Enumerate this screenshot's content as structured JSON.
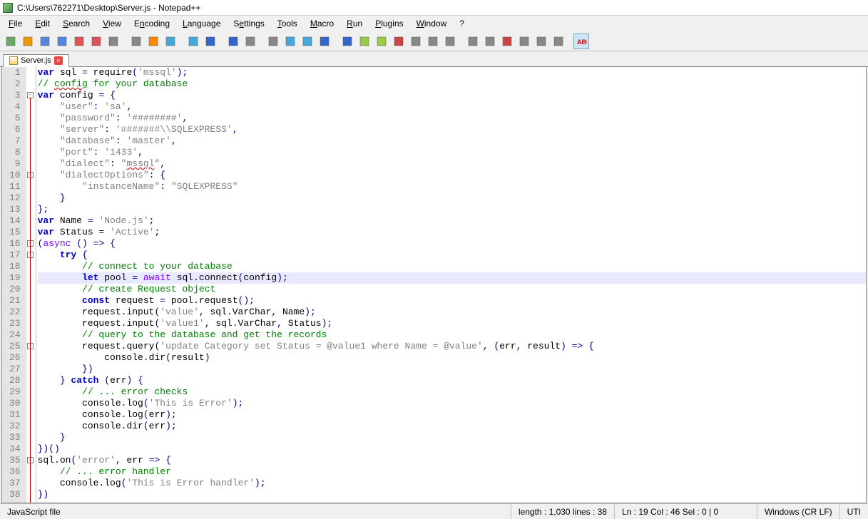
{
  "window": {
    "title": "C:\\Users\\762271\\Desktop\\Server.js - Notepad++"
  },
  "menu": [
    "File",
    "Edit",
    "Search",
    "View",
    "Encoding",
    "Language",
    "Settings",
    "Tools",
    "Macro",
    "Run",
    "Plugins",
    "Window",
    "?"
  ],
  "menu_underline_idx": [
    0,
    0,
    0,
    0,
    1,
    0,
    1,
    0,
    0,
    0,
    0,
    0,
    0
  ],
  "toolbar_icons": [
    "new-icon",
    "open-icon",
    "save-icon",
    "save-all-icon",
    "close-icon",
    "close-all-icon",
    "print-icon",
    "",
    "cut-icon",
    "copy-icon",
    "paste-icon",
    "",
    "undo-icon",
    "redo-icon",
    "",
    "find-icon",
    "replace-icon",
    "",
    "zoom-in-icon",
    "zoom-out-icon",
    "sync-v-icon",
    "sync-h-icon",
    "",
    "wrap-icon",
    "all-chars-icon",
    "indent-icon",
    "lang-icon",
    "doc-map-icon",
    "func-list-icon",
    "folder-icon",
    "",
    "monitor-icon",
    "record-icon",
    "stop-icon",
    "play-icon",
    "play-multi-icon",
    "save-macro-icon",
    "",
    "spell-icon"
  ],
  "tab": {
    "label": "Server.js"
  },
  "highlight_line": 19,
  "lines": [
    {
      "n": 1,
      "fold": "",
      "seg": [
        [
          "kw",
          "var"
        ],
        [
          "",
          " sql "
        ],
        [
          "op",
          "="
        ],
        [
          "",
          " require"
        ],
        [
          "op",
          "("
        ],
        [
          "str",
          "'mssql'"
        ],
        [
          "op",
          ")"
        ],
        [
          "op",
          ";"
        ]
      ]
    },
    {
      "n": 2,
      "fold": "",
      "seg": [
        [
          "com",
          "// "
        ],
        [
          "com wavy",
          "config"
        ],
        [
          "com",
          " for your database"
        ]
      ]
    },
    {
      "n": 3,
      "fold": "box",
      "seg": [
        [
          "kw",
          "var"
        ],
        [
          "",
          " config "
        ],
        [
          "op",
          "="
        ],
        [
          "",
          " "
        ],
        [
          "op",
          "{"
        ]
      ]
    },
    {
      "n": 4,
      "fold": "",
      "seg": [
        [
          "",
          "    "
        ],
        [
          "str",
          "\"user\""
        ],
        [
          "op",
          ":"
        ],
        [
          "",
          " "
        ],
        [
          "str",
          "'sa'"
        ],
        [
          "op",
          ","
        ]
      ]
    },
    {
      "n": 5,
      "fold": "",
      "seg": [
        [
          "",
          "    "
        ],
        [
          "str",
          "\"password\""
        ],
        [
          "op",
          ":"
        ],
        [
          "",
          " "
        ],
        [
          "str",
          "'########'"
        ],
        [
          "op",
          ","
        ]
      ]
    },
    {
      "n": 6,
      "fold": "",
      "seg": [
        [
          "",
          "    "
        ],
        [
          "str",
          "\"server\""
        ],
        [
          "op",
          ":"
        ],
        [
          "",
          " "
        ],
        [
          "str",
          "'#######\\\\SQLEXPRESS'"
        ],
        [
          "op",
          ","
        ]
      ]
    },
    {
      "n": 7,
      "fold": "",
      "seg": [
        [
          "",
          "    "
        ],
        [
          "str",
          "\"database\""
        ],
        [
          "op",
          ":"
        ],
        [
          "",
          " "
        ],
        [
          "str",
          "'master'"
        ],
        [
          "op",
          ","
        ]
      ]
    },
    {
      "n": 8,
      "fold": "",
      "seg": [
        [
          "",
          "    "
        ],
        [
          "str",
          "\"port\""
        ],
        [
          "op",
          ":"
        ],
        [
          "",
          " "
        ],
        [
          "str",
          "'1433'"
        ],
        [
          "op",
          ","
        ]
      ]
    },
    {
      "n": 9,
      "fold": "",
      "seg": [
        [
          "",
          "    "
        ],
        [
          "str",
          "\"dialect\""
        ],
        [
          "op",
          ":"
        ],
        [
          "",
          " "
        ],
        [
          "str",
          "\""
        ],
        [
          "str wavy",
          "mssql"
        ],
        [
          "str",
          "\""
        ],
        [
          "op",
          ","
        ]
      ]
    },
    {
      "n": 10,
      "fold": "box",
      "seg": [
        [
          "",
          "    "
        ],
        [
          "str",
          "\"dialectOptions\""
        ],
        [
          "op",
          ":"
        ],
        [
          "",
          " "
        ],
        [
          "op",
          "{"
        ]
      ]
    },
    {
      "n": 11,
      "fold": "",
      "seg": [
        [
          "",
          "        "
        ],
        [
          "str",
          "\"instanceName\""
        ],
        [
          "op",
          ":"
        ],
        [
          "",
          " "
        ],
        [
          "str",
          "\"SQLEXPRESS\""
        ]
      ]
    },
    {
      "n": 12,
      "fold": "",
      "seg": [
        [
          "",
          "    "
        ],
        [
          "op",
          "}"
        ]
      ]
    },
    {
      "n": 13,
      "fold": "",
      "seg": [
        [
          "op",
          "}"
        ],
        [
          "op",
          ";"
        ]
      ]
    },
    {
      "n": 14,
      "fold": "",
      "seg": [
        [
          "kw",
          "var"
        ],
        [
          "",
          " Name "
        ],
        [
          "op",
          "="
        ],
        [
          "",
          " "
        ],
        [
          "str",
          "'Node.js'"
        ],
        [
          "op",
          ";"
        ]
      ]
    },
    {
      "n": 15,
      "fold": "",
      "seg": [
        [
          "kw",
          "var"
        ],
        [
          "",
          " Status "
        ],
        [
          "op",
          "="
        ],
        [
          "",
          " "
        ],
        [
          "str",
          "'Active'"
        ],
        [
          "op",
          ";"
        ]
      ]
    },
    {
      "n": 16,
      "fold": "box",
      "seg": [
        [
          "op",
          "("
        ],
        [
          "kw2",
          "async"
        ],
        [
          "",
          " "
        ],
        [
          "op",
          "()"
        ],
        [
          "",
          " "
        ],
        [
          "op",
          "=>"
        ],
        [
          "",
          " "
        ],
        [
          "op",
          "{"
        ]
      ]
    },
    {
      "n": 17,
      "fold": "box",
      "seg": [
        [
          "",
          "    "
        ],
        [
          "kw",
          "try"
        ],
        [
          "",
          " "
        ],
        [
          "op",
          "{"
        ]
      ]
    },
    {
      "n": 18,
      "fold": "",
      "seg": [
        [
          "",
          "        "
        ],
        [
          "com",
          "// connect to your database"
        ]
      ]
    },
    {
      "n": 19,
      "fold": "",
      "seg": [
        [
          "",
          "        "
        ],
        [
          "kw",
          "let"
        ],
        [
          "",
          " pool "
        ],
        [
          "op",
          "="
        ],
        [
          "",
          " "
        ],
        [
          "kw2",
          "await"
        ],
        [
          "",
          " sql"
        ],
        [
          "op",
          "."
        ],
        [
          "",
          "connect"
        ],
        [
          "op",
          "("
        ],
        [
          "",
          "config"
        ],
        [
          "op",
          ")"
        ],
        [
          "op",
          ";"
        ]
      ]
    },
    {
      "n": 20,
      "fold": "",
      "seg": [
        [
          "",
          "        "
        ],
        [
          "com",
          "// create Request object"
        ]
      ]
    },
    {
      "n": 21,
      "fold": "",
      "seg": [
        [
          "",
          "        "
        ],
        [
          "kw",
          "const"
        ],
        [
          "",
          " request "
        ],
        [
          "op",
          "="
        ],
        [
          "",
          " pool"
        ],
        [
          "op",
          "."
        ],
        [
          "",
          "request"
        ],
        [
          "op",
          "()"
        ],
        [
          "op",
          ";"
        ]
      ]
    },
    {
      "n": 22,
      "fold": "",
      "seg": [
        [
          "",
          "        request"
        ],
        [
          "op",
          "."
        ],
        [
          "",
          "input"
        ],
        [
          "op",
          "("
        ],
        [
          "str",
          "'value'"
        ],
        [
          "op",
          ","
        ],
        [
          "",
          " sql"
        ],
        [
          "op",
          "."
        ],
        [
          "",
          "VarChar"
        ],
        [
          "op",
          ","
        ],
        [
          "",
          " Name"
        ],
        [
          "op",
          ")"
        ],
        [
          "op",
          ";"
        ]
      ]
    },
    {
      "n": 23,
      "fold": "",
      "seg": [
        [
          "",
          "        request"
        ],
        [
          "op",
          "."
        ],
        [
          "",
          "input"
        ],
        [
          "op",
          "("
        ],
        [
          "str",
          "'value1'"
        ],
        [
          "op",
          ","
        ],
        [
          "",
          " sql"
        ],
        [
          "op",
          "."
        ],
        [
          "",
          "VarChar"
        ],
        [
          "op",
          ","
        ],
        [
          "",
          " Status"
        ],
        [
          "op",
          ")"
        ],
        [
          "op",
          ";"
        ]
      ]
    },
    {
      "n": 24,
      "fold": "",
      "seg": [
        [
          "",
          "        "
        ],
        [
          "com",
          "// query to the database and get the records"
        ]
      ]
    },
    {
      "n": 25,
      "fold": "box",
      "seg": [
        [
          "",
          "        request"
        ],
        [
          "op",
          "."
        ],
        [
          "",
          "query"
        ],
        [
          "op",
          "("
        ],
        [
          "str",
          "'update Category set Status = @value1 where Name = @value'"
        ],
        [
          "op",
          ","
        ],
        [
          "",
          " "
        ],
        [
          "op",
          "("
        ],
        [
          "",
          "err"
        ],
        [
          "op",
          ","
        ],
        [
          "",
          " result"
        ],
        [
          "op",
          ")"
        ],
        [
          "",
          " "
        ],
        [
          "op",
          "=>"
        ],
        [
          "",
          " "
        ],
        [
          "op",
          "{"
        ]
      ]
    },
    {
      "n": 26,
      "fold": "",
      "seg": [
        [
          "",
          "            console"
        ],
        [
          "op",
          "."
        ],
        [
          "",
          "dir"
        ],
        [
          "op",
          "("
        ],
        [
          "",
          "result"
        ],
        [
          "op",
          ")"
        ]
      ]
    },
    {
      "n": 27,
      "fold": "",
      "seg": [
        [
          "",
          "        "
        ],
        [
          "op",
          "})"
        ]
      ]
    },
    {
      "n": 28,
      "fold": "",
      "seg": [
        [
          "",
          "    "
        ],
        [
          "op",
          "}"
        ],
        [
          "",
          " "
        ],
        [
          "kw",
          "catch"
        ],
        [
          "",
          " "
        ],
        [
          "op",
          "("
        ],
        [
          "",
          "err"
        ],
        [
          "op",
          ")"
        ],
        [
          "",
          " "
        ],
        [
          "op",
          "{"
        ]
      ]
    },
    {
      "n": 29,
      "fold": "",
      "seg": [
        [
          "",
          "        "
        ],
        [
          "com",
          "// ... error checks"
        ]
      ]
    },
    {
      "n": 30,
      "fold": "",
      "seg": [
        [
          "",
          "        console"
        ],
        [
          "op",
          "."
        ],
        [
          "",
          "log"
        ],
        [
          "op",
          "("
        ],
        [
          "str",
          "'This is Error'"
        ],
        [
          "op",
          ")"
        ],
        [
          "op",
          ";"
        ]
      ]
    },
    {
      "n": 31,
      "fold": "",
      "seg": [
        [
          "",
          "        console"
        ],
        [
          "op",
          "."
        ],
        [
          "",
          "log"
        ],
        [
          "op",
          "("
        ],
        [
          "",
          "err"
        ],
        [
          "op",
          ")"
        ],
        [
          "op",
          ";"
        ]
      ]
    },
    {
      "n": 32,
      "fold": "",
      "seg": [
        [
          "",
          "        console"
        ],
        [
          "op",
          "."
        ],
        [
          "",
          "dir"
        ],
        [
          "op",
          "("
        ],
        [
          "",
          "err"
        ],
        [
          "op",
          ")"
        ],
        [
          "op",
          ";"
        ]
      ]
    },
    {
      "n": 33,
      "fold": "",
      "seg": [
        [
          "",
          "    "
        ],
        [
          "op",
          "}"
        ]
      ]
    },
    {
      "n": 34,
      "fold": "",
      "seg": [
        [
          "op",
          "})()"
        ]
      ]
    },
    {
      "n": 35,
      "fold": "box",
      "seg": [
        [
          "",
          "sql"
        ],
        [
          "op",
          "."
        ],
        [
          "",
          "on"
        ],
        [
          "op",
          "("
        ],
        [
          "str",
          "'error'"
        ],
        [
          "op",
          ","
        ],
        [
          "",
          " err "
        ],
        [
          "op",
          "=>"
        ],
        [
          "",
          " "
        ],
        [
          "op",
          "{"
        ]
      ]
    },
    {
      "n": 36,
      "fold": "",
      "seg": [
        [
          "",
          "    "
        ],
        [
          "com",
          "// ... error handler"
        ]
      ]
    },
    {
      "n": 37,
      "fold": "",
      "seg": [
        [
          "",
          "    console"
        ],
        [
          "op",
          "."
        ],
        [
          "",
          "log"
        ],
        [
          "op",
          "("
        ],
        [
          "str",
          "'This is Error handler'"
        ],
        [
          "op",
          ")"
        ],
        [
          "op",
          ";"
        ]
      ]
    },
    {
      "n": 38,
      "fold": "",
      "seg": [
        [
          "op",
          "})"
        ]
      ]
    }
  ],
  "status": {
    "lang": "JavaScript file",
    "length": "length : 1,030    lines : 38",
    "pos": "Ln : 19    Col : 46    Sel : 0 | 0",
    "eol": "Windows (CR LF)",
    "enc": "UTI"
  }
}
